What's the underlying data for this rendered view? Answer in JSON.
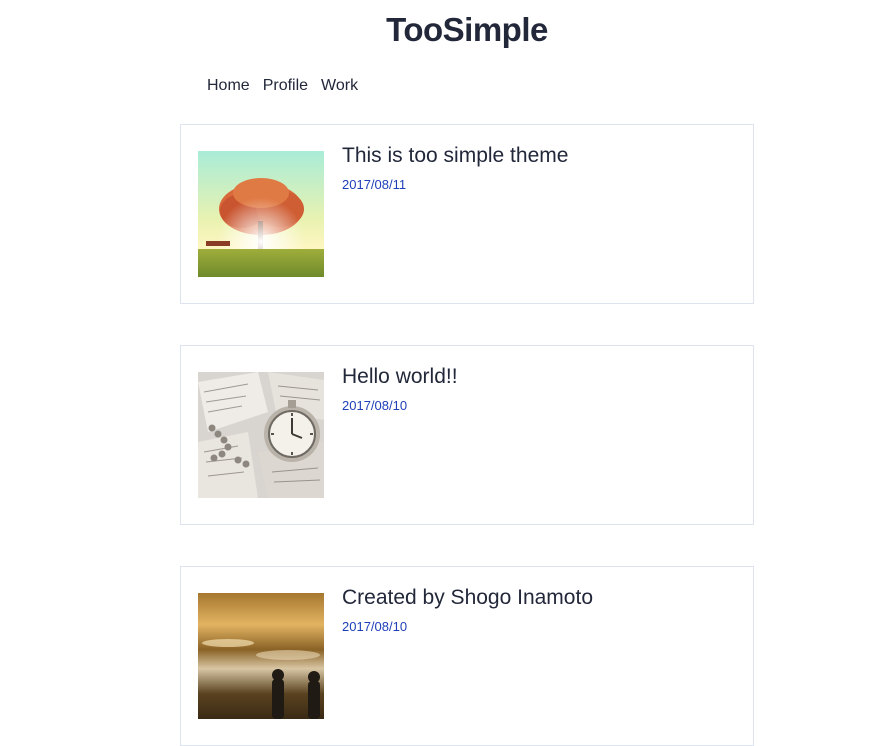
{
  "site": {
    "title": "TooSimple"
  },
  "nav": {
    "items": [
      {
        "label": "Home"
      },
      {
        "label": "Profile"
      },
      {
        "label": "Work"
      }
    ]
  },
  "posts": [
    {
      "title": "This is too simple theme",
      "date": "2017/08/11",
      "thumbnail": "tree-at-sunset"
    },
    {
      "title": "Hello world!!",
      "date": "2017/08/10",
      "thumbnail": "pocket-watch-on-map"
    },
    {
      "title": "Created by Shogo Inamoto",
      "date": "2017/08/10",
      "thumbnail": "cloudy-sky-silhouettes"
    }
  ],
  "colors": {
    "text": "#22283a",
    "date": "#1e3fb8",
    "card_border": "#dde3ef"
  }
}
